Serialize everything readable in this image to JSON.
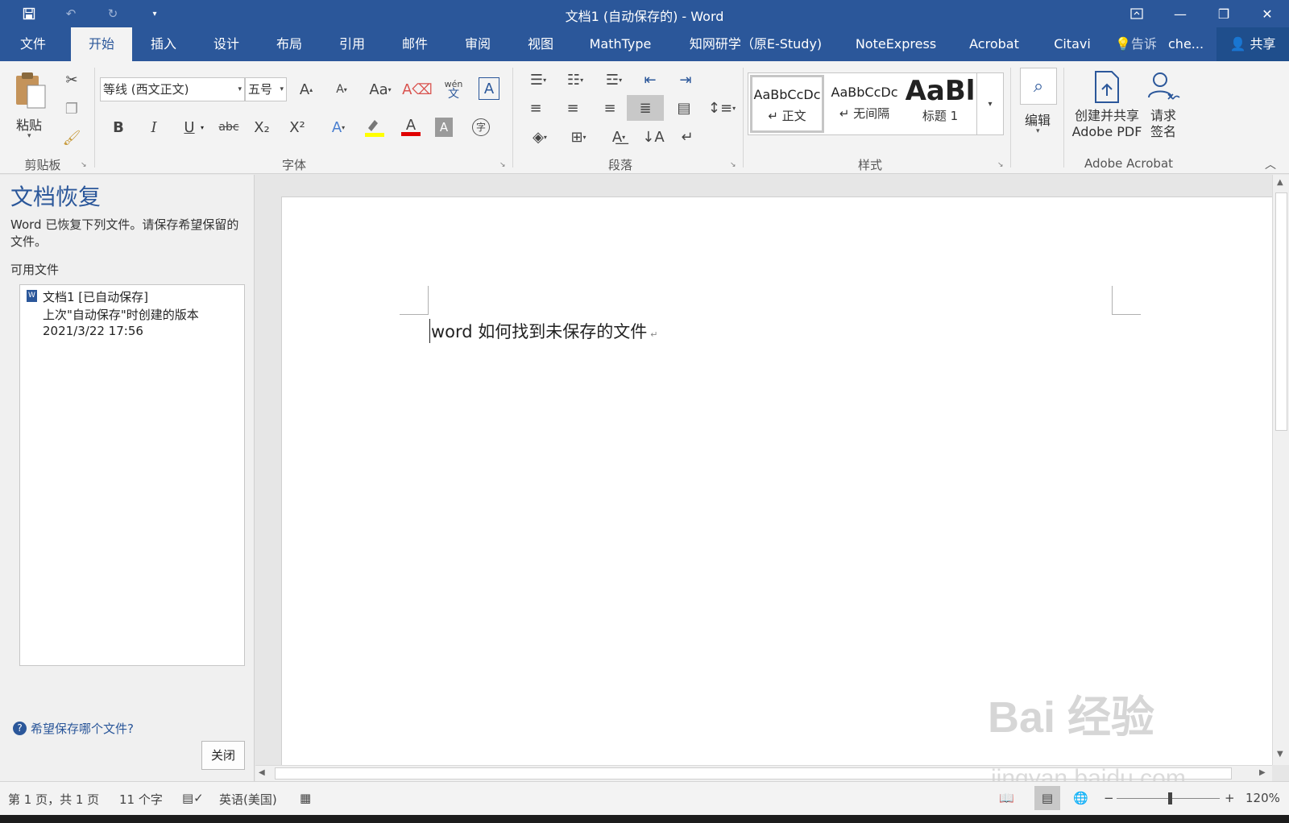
{
  "titlebar": {
    "title": "文档1 (自动保存的) - Word",
    "qat": {
      "save_icon": "save-icon",
      "undo_icon": "undo-icon",
      "redo_icon": "redo-icon",
      "customize_icon": "customize-qat-icon"
    }
  },
  "tabs": [
    {
      "label": "文件"
    },
    {
      "label": "开始"
    },
    {
      "label": "插入"
    },
    {
      "label": "设计"
    },
    {
      "label": "布局"
    },
    {
      "label": "引用"
    },
    {
      "label": "邮件"
    },
    {
      "label": "审阅"
    },
    {
      "label": "视图"
    },
    {
      "label": "MathType"
    },
    {
      "label": "知网研学（原E-Study)"
    },
    {
      "label": "NoteExpress"
    },
    {
      "label": "Acrobat"
    },
    {
      "label": "Citavi"
    }
  ],
  "tell_me": "告诉",
  "user": "che...",
  "share": "共享",
  "ribbon": {
    "clipboard": {
      "paste": "粘贴",
      "label": "剪贴板"
    },
    "font": {
      "label": "字体",
      "font_name": "等线 (西文正文)",
      "font_size": "五号",
      "case_btn": "Aa",
      "phonetic_top": "wén",
      "phonetic_bottom": "文",
      "bold": "B",
      "italic": "I",
      "underline": "U",
      "strike": "abc",
      "sub": "X₂",
      "sup": "X²",
      "char_circle": "字"
    },
    "paragraph": {
      "label": "段落"
    },
    "styles": {
      "label": "样式",
      "items": [
        {
          "sample": "AaBbCcDc",
          "name": "↵ 正文"
        },
        {
          "sample": "AaBbCcDc",
          "name": "↵ 无间隔"
        },
        {
          "sample": "AaBl",
          "name": "标题 1"
        }
      ]
    },
    "editing": {
      "label": "编辑"
    },
    "acrobat": {
      "label": "Adobe Acrobat",
      "create_line1": "创建并共享",
      "create_line2": "Adobe PDF",
      "sign_line1": "请求",
      "sign_line2": "签名"
    }
  },
  "recovery": {
    "title": "文档恢复",
    "description": "Word 已恢复下列文件。请保存希望保留的文件。",
    "available_label": "可用文件",
    "files": [
      {
        "name": "文档1  [已自动保存]",
        "detail": "上次\"自动保存\"时创建的版本",
        "date": "2021/3/22 17:56"
      }
    ],
    "help_link": "希望保存哪个文件?",
    "close_button": "关闭"
  },
  "document": {
    "text": "word 如何找到未保存的文件"
  },
  "statusbar": {
    "page": "第 1 页，共 1 页",
    "words": "11 个字",
    "language": "英语(美国)",
    "zoom": "120%"
  },
  "watermark": {
    "main": "Bai 经验",
    "sub": "jingyan.baidu.com"
  }
}
